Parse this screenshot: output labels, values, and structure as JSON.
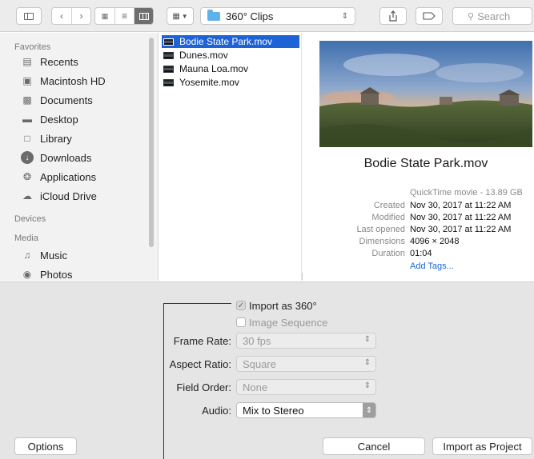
{
  "toolbar": {
    "path_label": "360° Clips",
    "search_placeholder": "Search"
  },
  "sidebar": {
    "favorites_header": "Favorites",
    "favorites": [
      {
        "label": "Recents",
        "icon": "recents-icon"
      },
      {
        "label": "Macintosh HD",
        "icon": "hard-drive-icon"
      },
      {
        "label": "Documents",
        "icon": "documents-icon"
      },
      {
        "label": "Desktop",
        "icon": "desktop-icon"
      },
      {
        "label": "Library",
        "icon": "folder-icon"
      },
      {
        "label": "Downloads",
        "icon": "downloads-icon"
      },
      {
        "label": "Applications",
        "icon": "applications-icon"
      },
      {
        "label": "iCloud Drive",
        "icon": "cloud-icon"
      }
    ],
    "devices_header": "Devices",
    "media_header": "Media",
    "media": [
      {
        "label": "Music",
        "icon": "music-icon"
      },
      {
        "label": "Photos",
        "icon": "camera-icon"
      }
    ]
  },
  "files": [
    {
      "name": "Bodie State Park.mov",
      "selected": true
    },
    {
      "name": "Dunes.mov",
      "selected": false
    },
    {
      "name": "Mauna Loa.mov",
      "selected": false
    },
    {
      "name": "Yosemite.mov",
      "selected": false
    }
  ],
  "preview": {
    "filename": "Bodie State Park.mov",
    "kind": "QuickTime movie - 13.89 GB",
    "created_label": "Created",
    "created": "Nov 30, 2017 at 11:22 AM",
    "modified_label": "Modified",
    "modified": "Nov 30, 2017 at 11:22 AM",
    "last_opened_label": "Last opened",
    "last_opened": "Nov 30, 2017 at 11:22 AM",
    "dimensions_label": "Dimensions",
    "dimensions": "4096 × 2048",
    "duration_label": "Duration",
    "duration": "01:04",
    "add_tags": "Add Tags..."
  },
  "options": {
    "import_360_label": "Import as 360°",
    "import_360_checked": true,
    "image_sequence_label": "Image Sequence",
    "image_sequence_checked": false,
    "frame_rate_label": "Frame Rate:",
    "frame_rate_value": "30 fps",
    "aspect_ratio_label": "Aspect Ratio:",
    "aspect_ratio_value": "Square",
    "field_order_label": "Field Order:",
    "field_order_value": "None",
    "audio_label": "Audio:",
    "audio_value": "Mix to Stereo"
  },
  "buttons": {
    "options": "Options",
    "cancel": "Cancel",
    "import": "Import as Project"
  },
  "colors": {
    "selection": "#1d63d6",
    "link": "#1a66d6",
    "folder_accent": "#5fb1ea"
  }
}
